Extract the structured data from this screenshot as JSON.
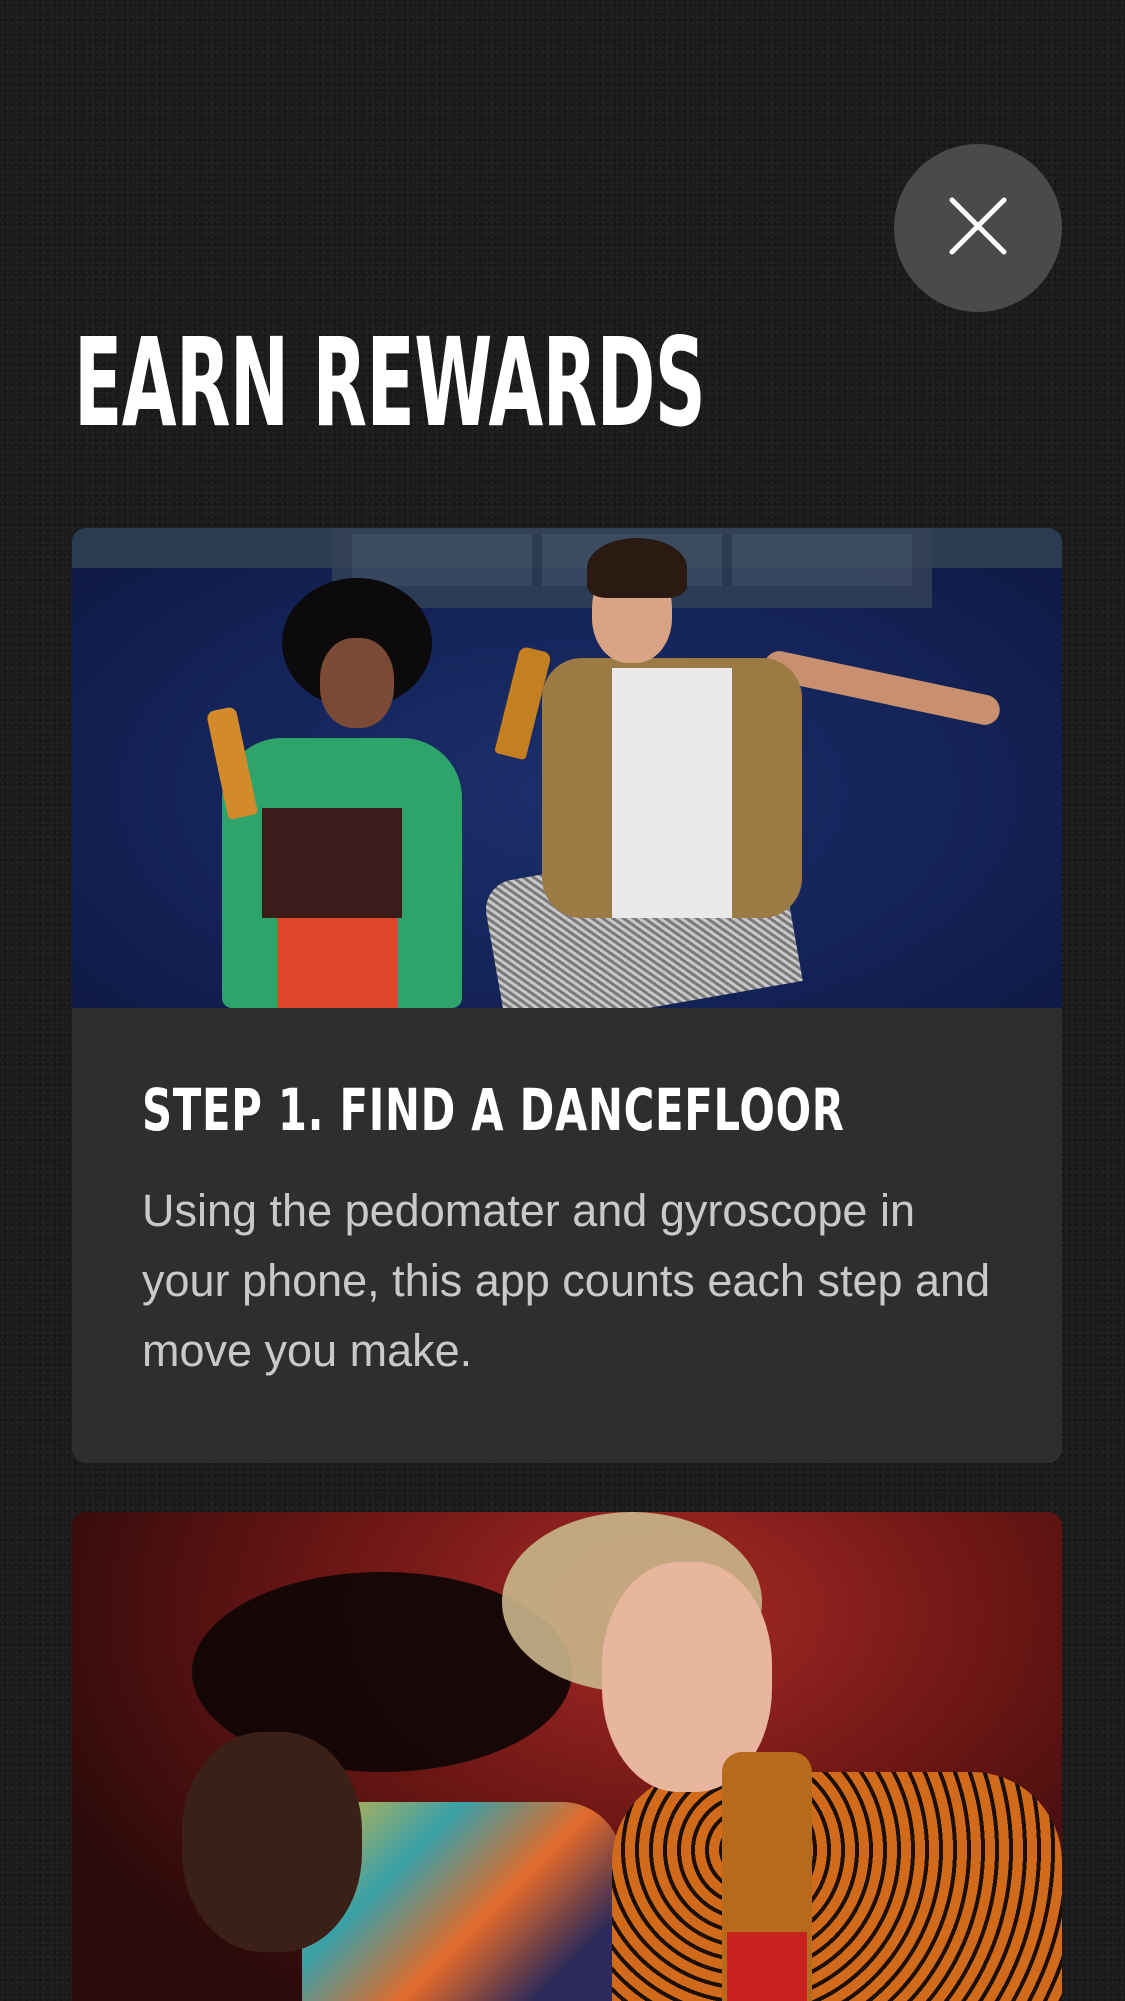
{
  "header": {
    "title": "EARN REWARDS"
  },
  "close_button": {
    "icon": "close-icon"
  },
  "cards": [
    {
      "title": "STEP 1. FIND A DANCEFLOOR",
      "description": "Using the pedomater and gyroscope in your phone, this app counts each step and move you make."
    },
    {
      "title": "",
      "description": ""
    }
  ],
  "colors": {
    "background": "#1c1c1c",
    "card": "#2e2e2f",
    "close_button": "#4a4a4a",
    "title_text": "#ffffff",
    "body_text": "#c9c9c9"
  }
}
